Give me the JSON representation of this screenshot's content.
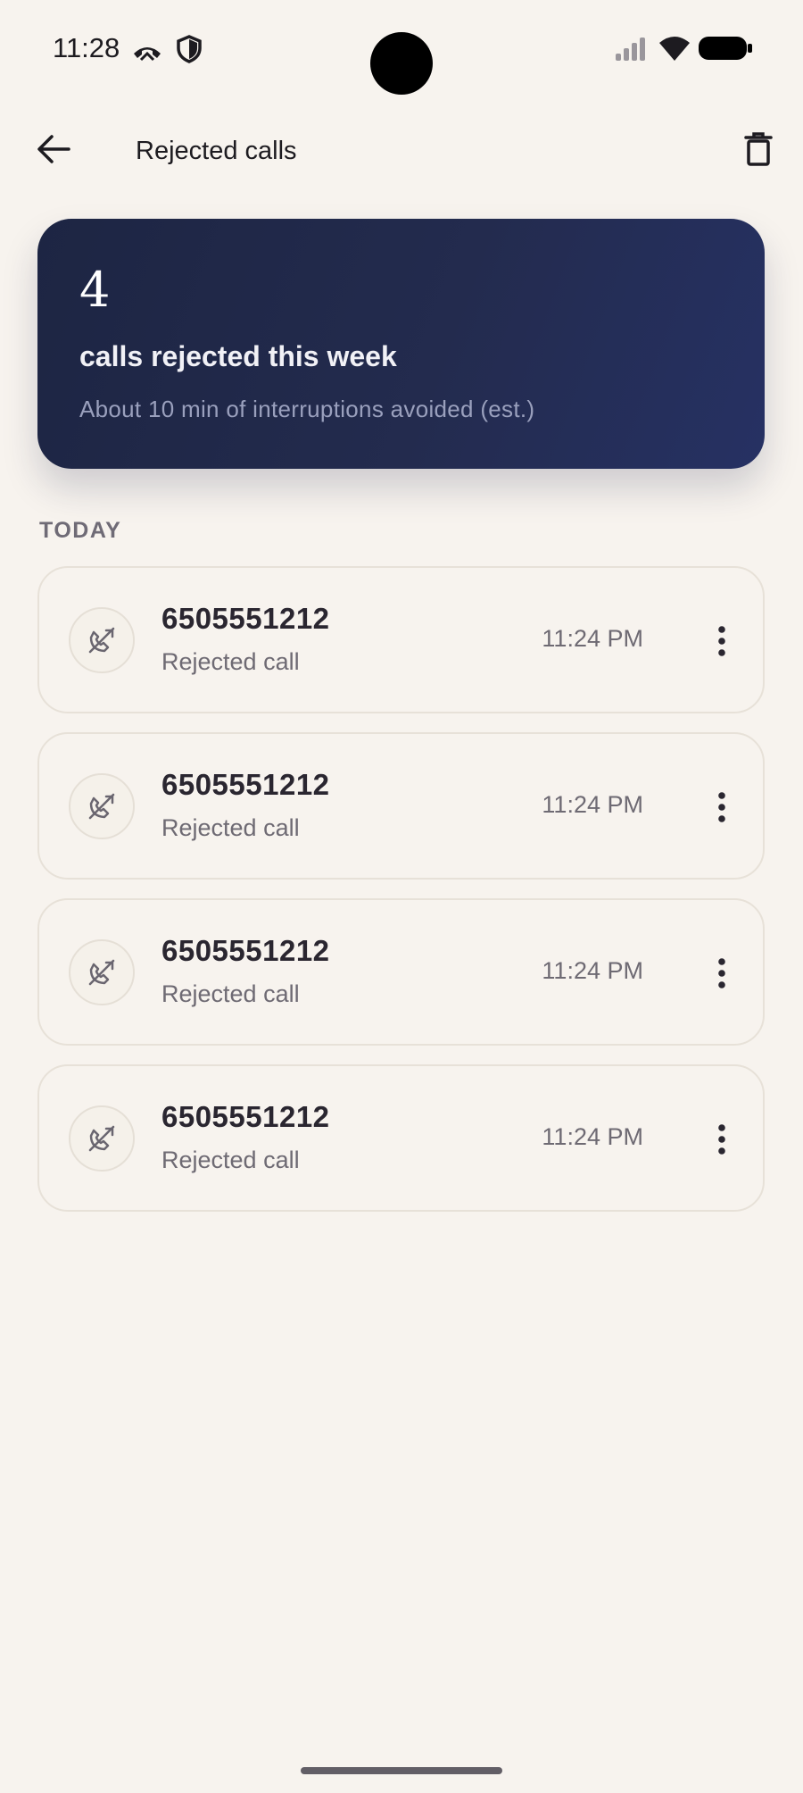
{
  "status_bar": {
    "time": "11:28"
  },
  "app_bar": {
    "title": "Rejected calls",
    "back_icon": "arrow-left-icon",
    "delete_icon": "trash-icon"
  },
  "summary": {
    "count": "4",
    "label": "calls rejected this week",
    "subtitle": "About 10 min of interruptions avoided (est.)"
  },
  "section": {
    "header": "TODAY"
  },
  "calls": [
    {
      "number": "6505551212",
      "status": "Rejected call",
      "time": "11:24 PM"
    },
    {
      "number": "6505551212",
      "status": "Rejected call",
      "time": "11:24 PM"
    },
    {
      "number": "6505551212",
      "status": "Rejected call",
      "time": "11:24 PM"
    },
    {
      "number": "6505551212",
      "status": "Rejected call",
      "time": "11:24 PM"
    }
  ],
  "colors": {
    "background": "#f7f3ee",
    "card_start": "#1d2543",
    "card_end": "#263163",
    "muted_text": "#6e6a73"
  }
}
